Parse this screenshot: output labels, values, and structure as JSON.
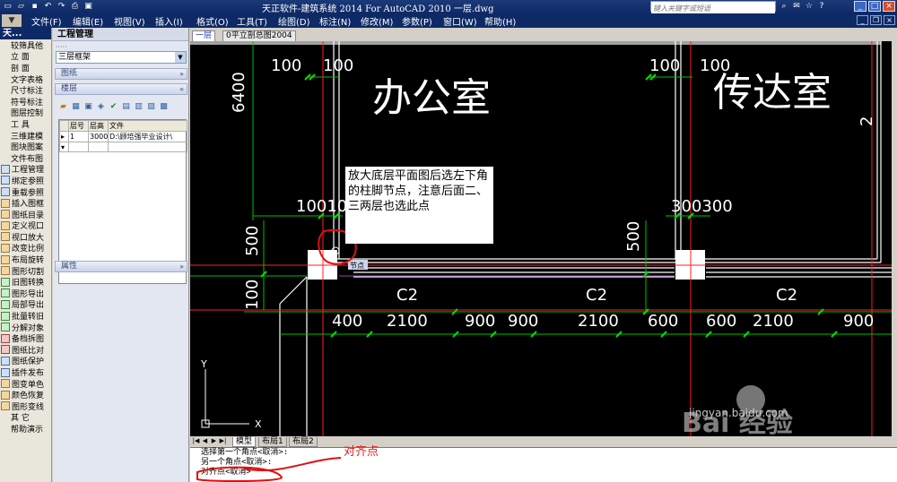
{
  "titlebar": {
    "title": "天正软件-建筑系统 2014  For AutoCAD 2010  一层.dwg",
    "search_placeholder": "键入关键字或短语"
  },
  "menu": [
    "文件(F)",
    "编辑(E)",
    "视图(V)",
    "插入(I)",
    "格式(O)",
    "工具(T)",
    "绘图(D)",
    "标注(N)",
    "修改(M)",
    "参数(P)",
    "窗口(W)",
    "帮助(H)"
  ],
  "tz_toolbar": {
    "header": "天...",
    "items": [
      {
        "label": "较筛具他",
        "kind": "sub"
      },
      {
        "label": "立    面",
        "kind": "sub"
      },
      {
        "label": "剖    面",
        "kind": "sub"
      },
      {
        "label": "文字表格",
        "kind": "sub"
      },
      {
        "label": "尺寸标注",
        "kind": "sub"
      },
      {
        "label": "符号标注",
        "kind": "sub"
      },
      {
        "label": "图层控制",
        "kind": "sub"
      },
      {
        "label": "工    具",
        "kind": "sub"
      },
      {
        "label": "三维建模",
        "kind": "sub"
      },
      {
        "label": "图块图案",
        "kind": "sub"
      },
      {
        "label": "文件布图",
        "kind": "sub"
      },
      {
        "label": "工程管理",
        "kind": "t1"
      },
      {
        "label": "绑定参照",
        "kind": "t1"
      },
      {
        "label": "重载参照",
        "kind": "t1"
      },
      {
        "label": "插入图框",
        "kind": "t2"
      },
      {
        "label": "图纸目录",
        "kind": "t2"
      },
      {
        "label": "定义视口",
        "kind": "t2"
      },
      {
        "label": "视口放大",
        "kind": "t2"
      },
      {
        "label": "改变比例",
        "kind": "t2"
      },
      {
        "label": "布局旋转",
        "kind": "t2"
      },
      {
        "label": "图形切割",
        "kind": "t2"
      },
      {
        "label": "旧图转换",
        "kind": "t3"
      },
      {
        "label": "图形导出",
        "kind": "t3"
      },
      {
        "label": "局部导出",
        "kind": "t3"
      },
      {
        "label": "批量转旧",
        "kind": "t3"
      },
      {
        "label": "分解对象",
        "kind": "t3"
      },
      {
        "label": "备档拆图",
        "kind": "t4"
      },
      {
        "label": "图纸比对",
        "kind": "t4"
      },
      {
        "label": "图纸保护",
        "kind": "t1"
      },
      {
        "label": "插件发布",
        "kind": "t1"
      },
      {
        "label": "图变单色",
        "kind": "t2"
      },
      {
        "label": "颜色恢复",
        "kind": "t2"
      },
      {
        "label": "图形变线",
        "kind": "t2"
      },
      {
        "label": "其    它",
        "kind": "sub"
      },
      {
        "label": "帮助演示",
        "kind": "sub"
      }
    ]
  },
  "project_panel": {
    "title": "工程管理",
    "project": "三层框架",
    "section_drawings": "图纸",
    "section_floors": "楼层",
    "section_props": "属性",
    "table": {
      "headers": [
        "层号",
        "层高",
        "文件"
      ],
      "rows": [
        [
          "1",
          "3000",
          "D:\\顾培强毕业设计\\"
        ]
      ]
    }
  },
  "doc_tabs": [
    "一层",
    "0平立剖总图2004"
  ],
  "layout_tabs": [
    "模型",
    "布局1",
    "布局2"
  ],
  "drawing": {
    "room1": "办公室",
    "room2": "传达室",
    "dims_top": [
      "100",
      "100",
      "100",
      "100"
    ],
    "dim_6400": "6400",
    "dim_2": "2",
    "dims_col1": "100100",
    "dims_col2": "300300",
    "dim_500a": "500",
    "dim_500b": "500",
    "dim_100": "100",
    "window_labels": [
      "C2",
      "C2",
      "C2"
    ],
    "dims_bottom": [
      "400",
      "2100",
      "900",
      "900",
      "2100",
      "600",
      "600",
      "2100",
      "900"
    ],
    "snap_tip": "节点",
    "ucs_x": "X",
    "ucs_y": "Y",
    "callout": "放大底层平面图后选左下角的柱脚节点，注意后面二、三两层也选此点",
    "watermark_main": "Bai 经验",
    "watermark_url": "jingyan.baidu.com"
  },
  "cmdline": {
    "line1": "选择第一个角点<取消>:",
    "line2": "另一个角点<取消>:",
    "line3": "对齐点<取消>",
    "annotation": "对齐点"
  },
  "colors": {
    "canvas": "#000000",
    "wall": "#ffffff",
    "axis": "#ff2020",
    "dim": "#00c000",
    "title": "#0e2a66"
  }
}
